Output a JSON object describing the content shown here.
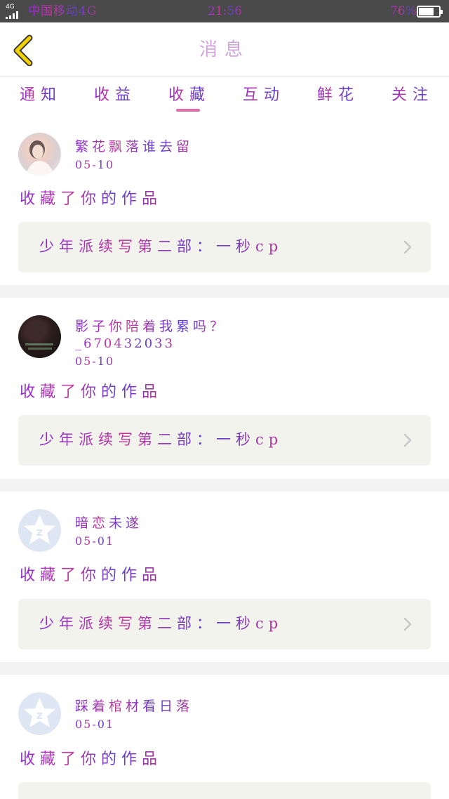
{
  "status_bar": {
    "network": "4G",
    "carrier": "中国移动4G",
    "time": "21:56",
    "battery_percent": "76%",
    "battery_level": 0.76
  },
  "header": {
    "back_icon": "chevron-left-icon",
    "title": "消息",
    "accent_color": "#f2d200"
  },
  "tabs": [
    {
      "label": "通知",
      "active": false
    },
    {
      "label": "收益",
      "active": false
    },
    {
      "label": "收藏",
      "active": true
    },
    {
      "label": "互动",
      "active": false
    },
    {
      "label": "鲜花",
      "active": false
    },
    {
      "label": "关注",
      "active": false
    }
  ],
  "tab_indicator_color": "#e06aa8",
  "messages": [
    {
      "user_name": "繁花飘落谁去留",
      "date": "05-10",
      "action": "收藏了你的作品",
      "work_title": "少年派续写第二部：一秒cp",
      "avatar": "user-photo"
    },
    {
      "user_name": "影子你陪着我累吗？",
      "user_name_line2": "_670432033",
      "date": "05-10",
      "action": "收藏了你的作品",
      "work_title": "少年派续写第二部：一秒cp",
      "avatar": "user-photo"
    },
    {
      "user_name": "暗恋未遂",
      "date": "05-01",
      "action": "收藏了你的作品",
      "work_title": "少年派续写第二部：一秒cp",
      "avatar": "default-avatar-icon"
    },
    {
      "user_name": "踩着棺材看日落",
      "date": "05-01",
      "action": "收藏了你的作品",
      "avatar": "default-avatar-icon"
    }
  ]
}
